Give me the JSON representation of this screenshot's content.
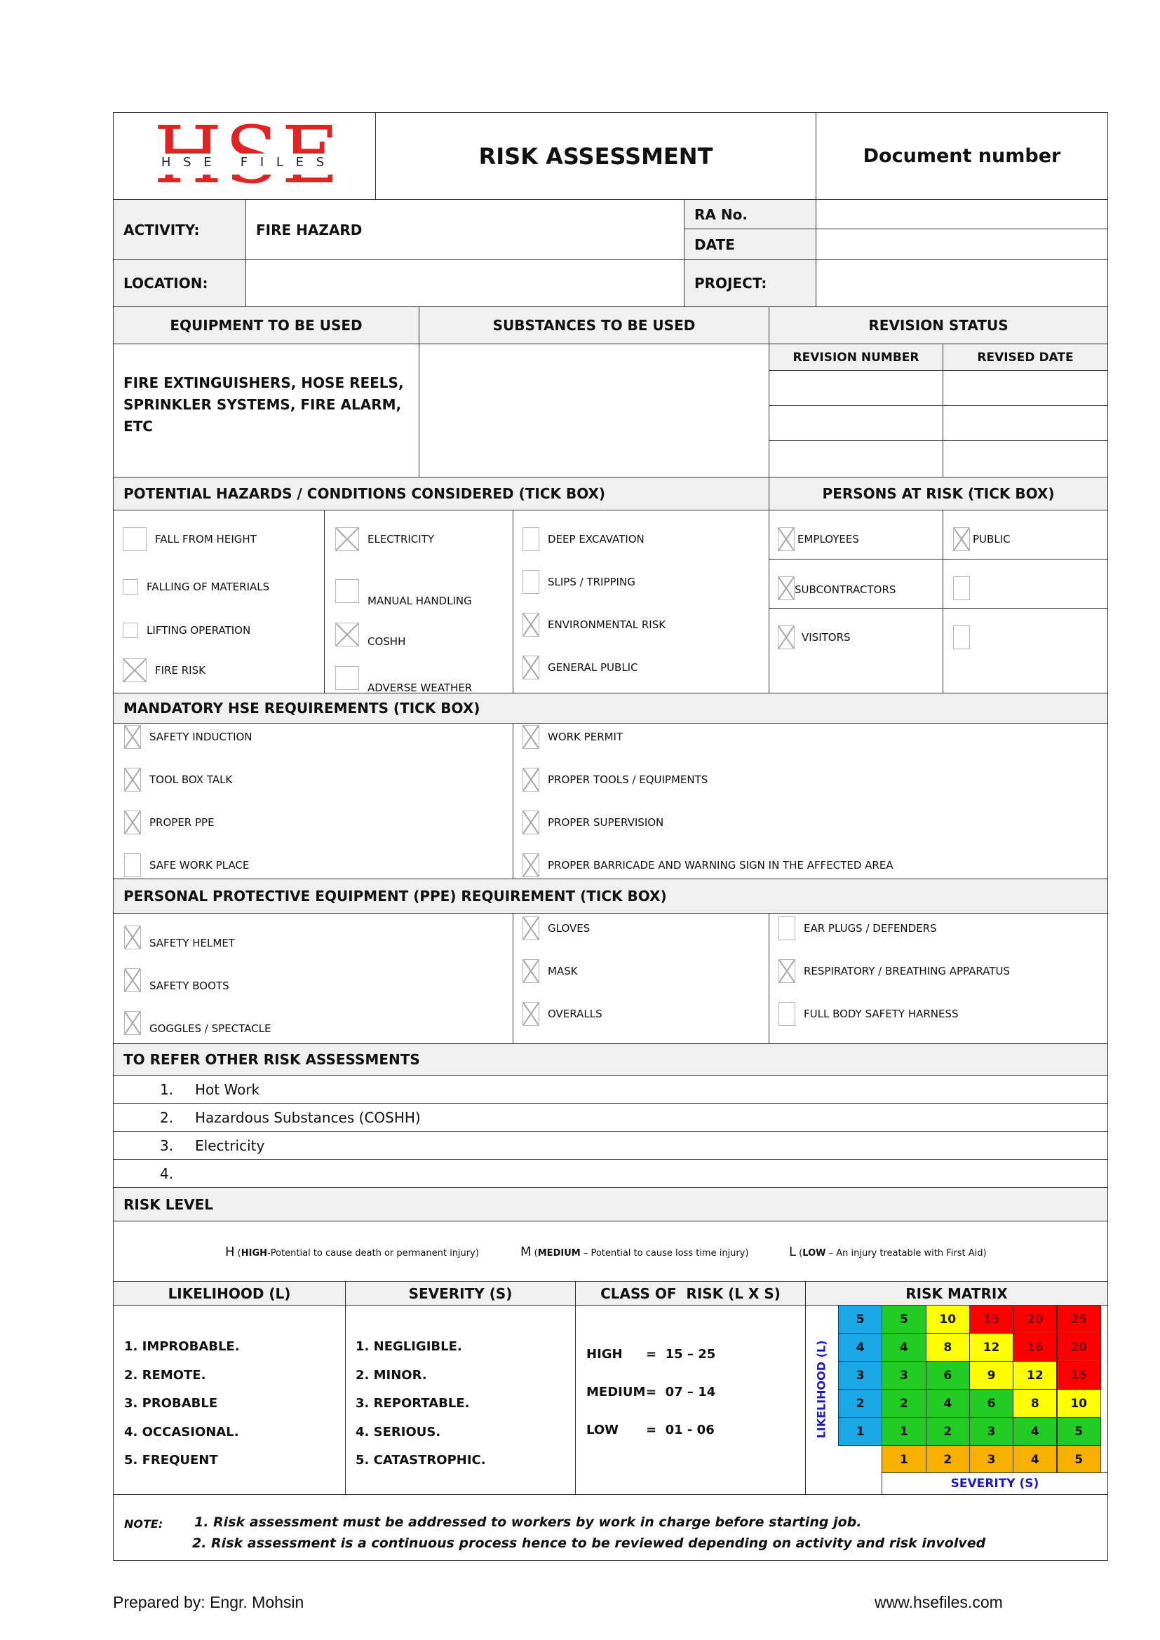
{
  "header": {
    "logo": {
      "big_letters": "HSE",
      "small_text": "H S E   F I L E S"
    },
    "title": "RISK ASSESSMENT",
    "document_number_label": "Document number"
  },
  "info": {
    "activity_label": "ACTIVITY:",
    "activity_value": "FIRE HAZARD",
    "ra_no_label": "RA No.",
    "ra_no_value": "",
    "date_label": "DATE",
    "date_value": "",
    "location_label": "LOCATION:",
    "location_value": "",
    "project_label": "PROJECT:",
    "project_value": ""
  },
  "equipment": {
    "equipment_header": "EQUIPMENT TO BE USED",
    "substances_header": "SUBSTANCES TO BE USED",
    "revision_header": "REVISION STATUS",
    "equipment_lines": [
      "FIRE EXTINGUISHERS, HOSE REELS,",
      "SPRINKLER SYSTEMS, FIRE ALARM,",
      "ETC"
    ],
    "substances_value": "",
    "revision_number_header": "REVISION NUMBER",
    "revised_date_header": "REVISED DATE",
    "revision_rows": [
      {
        "number": "",
        "date": ""
      },
      {
        "number": "",
        "date": ""
      },
      {
        "number": "",
        "date": ""
      }
    ]
  },
  "hazards": {
    "header": "POTENTIAL HAZARDS / CONDITIONS CONSIDERED (TICK BOX)",
    "persons_header": "PERSONS AT RISK (TICK BOX)",
    "columns": [
      [
        {
          "label": "FALL FROM HEIGHT",
          "checked": false
        },
        {
          "label": "FALLING OF MATERIALS",
          "checked": false
        },
        {
          "label": "LIFTING OPERATION",
          "checked": false
        },
        {
          "label": "FIRE RISK",
          "checked": true
        }
      ],
      [
        {
          "label": "ELECTRICITY",
          "checked": true
        },
        {
          "label": "MANUAL HANDLING",
          "checked": false
        },
        {
          "label": "COSHH",
          "checked": true
        },
        {
          "label": "ADVERSE WEATHER",
          "checked": false
        }
      ],
      [
        {
          "label": "DEEP EXCAVATION",
          "checked": false
        },
        {
          "label": "SLIPS / TRIPPING",
          "checked": false
        },
        {
          "label": "ENVIRONMENTAL RISK",
          "checked": true
        },
        {
          "label": "GENERAL PUBLIC",
          "checked": true
        }
      ]
    ],
    "persons": [
      {
        "label": "EMPLOYEES",
        "checked": true
      },
      {
        "label": "PUBLIC",
        "checked": true
      },
      {
        "label": "SUBCONTRACTORS",
        "checked": true
      },
      {
        "label": "",
        "checked": false
      },
      {
        "label": "VISITORS",
        "checked": true
      },
      {
        "label": "",
        "checked": false
      }
    ]
  },
  "mandatory": {
    "header": "MANDATORY HSE REQUIREMENTS (TICK BOX)",
    "columns": [
      [
        {
          "label": "SAFETY INDUCTION",
          "checked": true
        },
        {
          "label": "TOOL BOX TALK",
          "checked": true
        },
        {
          "label": "PROPER PPE",
          "checked": true
        },
        {
          "label": "SAFE WORK PLACE",
          "checked": false
        }
      ],
      [
        {
          "label": "WORK PERMIT",
          "checked": true
        },
        {
          "label": "PROPER TOOLS / EQUIPMENTS",
          "checked": true
        },
        {
          "label": "PROPER SUPERVISION",
          "checked": true
        },
        {
          "label": "PROPER BARRICADE AND WARNING SIGN IN THE AFFECTED AREA",
          "checked": true
        }
      ]
    ]
  },
  "ppe": {
    "header": "PERSONAL PROTECTIVE EQUIPMENT (PPE) REQUIREMENT (TICK BOX)",
    "columns": [
      [
        {
          "label": "SAFETY HELMET",
          "checked": true
        },
        {
          "label": "SAFETY BOOTS",
          "checked": true
        },
        {
          "label": "GOGGLES / SPECTACLE",
          "checked": true
        }
      ],
      [
        {
          "label": "GLOVES",
          "checked": true
        },
        {
          "label": "MASK",
          "checked": true
        },
        {
          "label": "OVERALLS",
          "checked": true
        }
      ],
      [
        {
          "label": "EAR PLUGS / DEFENDERS",
          "checked": false
        },
        {
          "label": "RESPIRATORY / BREATHING APPARATUS",
          "checked": true
        },
        {
          "label": "FULL BODY SAFETY HARNESS",
          "checked": false
        }
      ]
    ]
  },
  "refer": {
    "header": "TO REFER OTHER RISK ASSESSMENTS",
    "items": [
      {
        "num": "1.",
        "text": "Hot Work"
      },
      {
        "num": "2.",
        "text": "Hazardous Substances (COSHH)"
      },
      {
        "num": "3.",
        "text": "Electricity"
      },
      {
        "num": "4.",
        "text": ""
      }
    ]
  },
  "risk_level": {
    "header": "RISK LEVEL",
    "legend": [
      {
        "letter": "H",
        "code": "HIGH",
        "desc": "-Potential to cause death or permanent injury)"
      },
      {
        "letter": "M",
        "code": "MEDIUM",
        "desc": " – Potential to cause loss time injury)"
      },
      {
        "letter": "L",
        "code": "LOW",
        "desc": " – An injury treatable with First Aid)"
      }
    ]
  },
  "matrix_section": {
    "likelihood_header": "LIKELIHOOD (L)",
    "severity_header": "SEVERITY (S)",
    "class_header": "CLASS OF  RISK (L X S)",
    "matrix_header": "RISK MATRIX",
    "likelihood_items": [
      "1. IMPROBABLE.",
      "2. REMOTE.",
      "3. PROBABLE",
      "4. OCCASIONAL.",
      "5. FREQUENT"
    ],
    "severity_items": [
      "1. NEGLIGIBLE.",
      "2. MINOR.",
      "3. REPORTABLE.",
      "4. SERIOUS.",
      "5. CATASTROPHIC."
    ],
    "class_items": [
      {
        "name": "HIGH",
        "range": "=  15 – 25"
      },
      {
        "name": "MEDIUM",
        "range": "=  07 – 14"
      },
      {
        "name": "LOW",
        "range": "=  01 - 06"
      }
    ],
    "matrix": {
      "likelihood_axis_label": "LIKELIHOOD (L)",
      "severity_axis_label": "SEVERITY (S)",
      "likelihood_values": [
        5,
        4,
        3,
        2,
        1
      ],
      "severity_values": [
        1,
        2,
        3,
        4,
        5
      ],
      "rows": [
        [
          5,
          10,
          15,
          20,
          25
        ],
        [
          4,
          8,
          12,
          16,
          20
        ],
        [
          3,
          6,
          9,
          12,
          15
        ],
        [
          2,
          4,
          6,
          8,
          10
        ],
        [
          1,
          2,
          3,
          4,
          5
        ]
      ],
      "colors": {
        "axis_blue": "#1ba8e6",
        "axis_orange": "#f7b000",
        "low": "#22cc22",
        "medium": "#ffff00",
        "high": "#ff0000",
        "label_blue": "#1a1acc",
        "high_text": "#7a0000"
      }
    }
  },
  "note": {
    "label": "NOTE:",
    "lines": [
      "1. Risk assessment must be addressed to workers by work in charge before starting job.",
      "2. Risk assessment is a continuous process hence to be reviewed depending on activity and risk involved"
    ]
  },
  "footer": {
    "prepared_by": "Prepared by: Engr. Mohsin",
    "website": "www.hsefiles.com"
  }
}
